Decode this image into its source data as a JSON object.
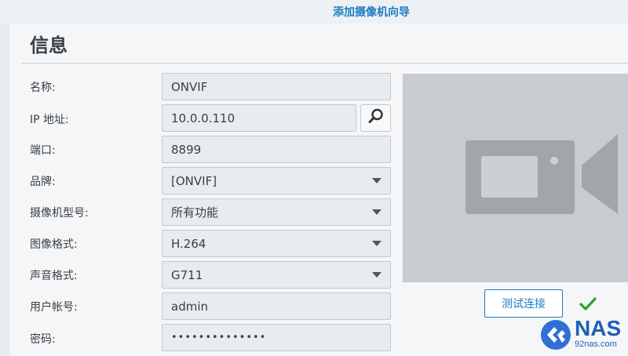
{
  "wizard": {
    "title": "添加摄像机向导"
  },
  "section": {
    "title": "信息"
  },
  "form": {
    "name": {
      "label": "名称:",
      "value": "ONVIF"
    },
    "ip": {
      "label": "IP 地址:",
      "value": "10.0.0.110"
    },
    "port": {
      "label": "端口:",
      "value": "8899"
    },
    "brand": {
      "label": "品牌:",
      "value": "[ONVIF]"
    },
    "model": {
      "label": "摄像机型号:",
      "value": "所有功能"
    },
    "video_format": {
      "label": "图像格式:",
      "value": "H.264"
    },
    "audio_format": {
      "label": "声音格式:",
      "value": "G711"
    },
    "username": {
      "label": "用户帐号:",
      "value": "admin"
    },
    "password": {
      "label": "密码:",
      "value": "••••••••••••••"
    }
  },
  "actions": {
    "test_connection": "测试连接"
  },
  "icons": {
    "search": "search-icon",
    "dropdown": "chevron-down-icon",
    "camera_preview": "video-camera-icon",
    "success": "checkmark-icon"
  },
  "colors": {
    "accent": "#1c7cc2",
    "success": "#2e9e2e"
  },
  "watermark": {
    "brand": "NAS",
    "site": "92nas.com"
  }
}
